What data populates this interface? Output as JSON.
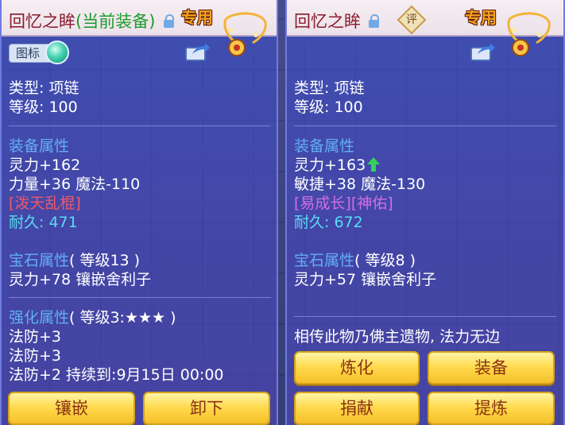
{
  "left_panel": {
    "title": "回忆之眸",
    "current_tag": "(当前装备)",
    "special_label": "专用",
    "icon_toggle_label": "图标",
    "type_line": "类型: 项链",
    "level_line": "等级: 100",
    "equip_heading": "装备属性",
    "attr1": "灵力+162",
    "attr2": "力量+36 魔法-110",
    "special_skill": "[泼天乱棍]",
    "durability_label": "耐久: ",
    "durability_value": "471",
    "gem_heading": "宝石属性",
    "gem_level": "( 等级13 )",
    "gem_attr": "灵力+78 镶嵌舍利子",
    "enhance_heading": "强化属性",
    "enhance_level": "( 等级3:★★★ )",
    "enhance1": "法防+3",
    "enhance2": "法防+3",
    "enhance3": "法防+2    持续到:9月15日 00:00",
    "buttons": [
      "镶嵌",
      "卸下"
    ]
  },
  "right_panel": {
    "title": "回忆之眸",
    "rate_badge": "评",
    "special_label": "专用",
    "type_line": "类型: 项链",
    "level_line": "等级: 100",
    "equip_heading": "装备属性",
    "attr1": "灵力+163",
    "attr2": "敏捷+38 魔法-130",
    "special_skill": "[易成长][神佑]",
    "durability_label": "耐久: ",
    "durability_value": "672",
    "gem_heading": "宝石属性",
    "gem_level": "( 等级8 )",
    "gem_attr": "灵力+57 镶嵌舍利子",
    "description": "相传此物乃佛主遗物, 法力无边",
    "buttons": [
      "炼化",
      "装备",
      "捐献",
      "提炼"
    ]
  },
  "colors": {
    "title": "#8b1a2b",
    "current": "#1f9b2c",
    "heading": "#62aef5",
    "red_skill": "#f05a6a",
    "purple_skill": "#d36fe3",
    "durability": "#58dcf2",
    "button_text": "#8a3310",
    "increase_arrow": "#35d35a"
  },
  "icons": [
    "lock-icon",
    "necklace-icon",
    "share-icon",
    "green-orb-icon",
    "rate-badge-icon",
    "up-arrow-icon"
  ]
}
